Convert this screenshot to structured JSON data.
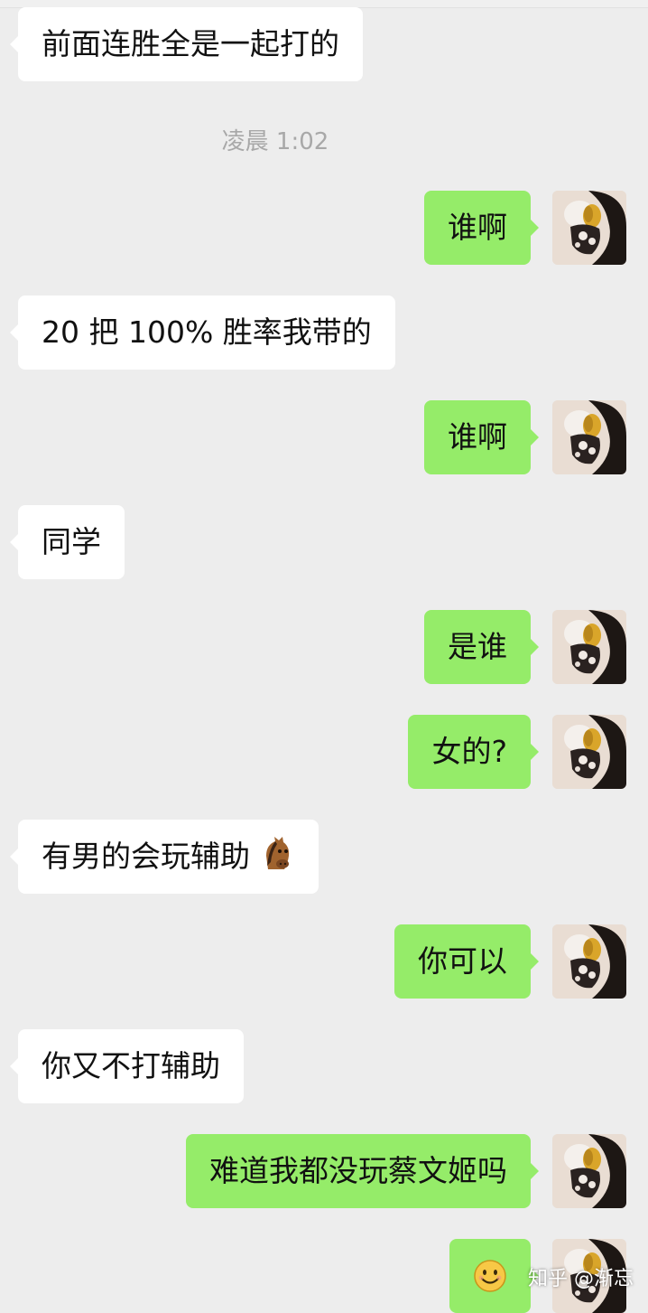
{
  "chat": {
    "timestamp": "凌晨 1:02",
    "messages": [
      {
        "side": "in",
        "text": "前面连胜全是一起打的"
      },
      {
        "side": "out",
        "text": "谁啊"
      },
      {
        "side": "in",
        "text": "20 把 100% 胜率我带的"
      },
      {
        "side": "out",
        "text": "谁啊"
      },
      {
        "side": "in",
        "text": "同学"
      },
      {
        "side": "out",
        "text": "是谁"
      },
      {
        "side": "out",
        "text": "女的?"
      },
      {
        "side": "in",
        "text": "有男的会玩辅助",
        "emoji": "horse-face-icon"
      },
      {
        "side": "out",
        "text": "你可以"
      },
      {
        "side": "in",
        "text": "你又不打辅助"
      },
      {
        "side": "out",
        "text": "难道我都没玩蔡文姬吗"
      },
      {
        "side": "out",
        "text": "",
        "emoji": "smiling-face-icon"
      }
    ]
  },
  "watermark": "知乎 @渐忘",
  "colors": {
    "background": "#ededed",
    "incoming_bubble": "#ffffff",
    "outgoing_bubble": "#95ec69",
    "timestamp_text": "#a8a8a8"
  }
}
